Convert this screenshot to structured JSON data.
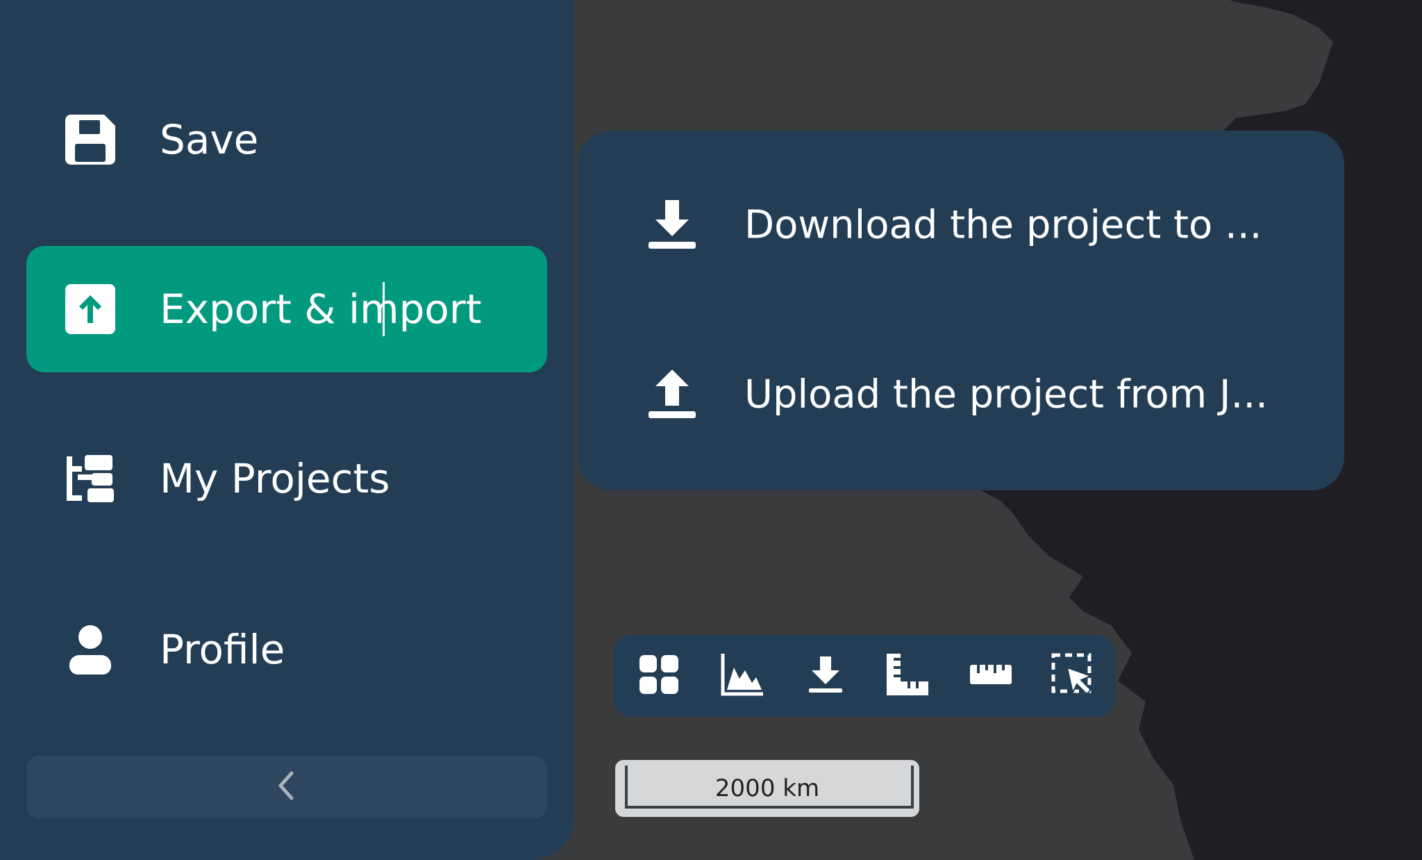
{
  "sidebar": {
    "items": [
      {
        "label": "Save",
        "icon": "floppy-disk-icon"
      },
      {
        "label": "Export & import",
        "icon": "upload-box-icon"
      },
      {
        "label": "My Projects",
        "icon": "project-tree-icon"
      },
      {
        "label": "Profile",
        "icon": "user-icon"
      }
    ],
    "collapse_icon": "chevron-left-icon"
  },
  "popover": {
    "items": [
      {
        "label": "Download the project to ...",
        "icon": "download-icon"
      },
      {
        "label": "Upload the project from J...",
        "icon": "upload-icon"
      }
    ]
  },
  "toolbar": {
    "tools": [
      "grid-icon",
      "elevation-chart-icon",
      "download-icon",
      "ruler-area-icon",
      "ruler-icon",
      "select-cursor-icon"
    ]
  },
  "scale_bar": {
    "label": "2000 km"
  },
  "colors": {
    "sidebar_bg": "#233d55",
    "active_item": "#029a7e",
    "map_land": "#3a3b3d",
    "map_water": "#1f1f23"
  }
}
